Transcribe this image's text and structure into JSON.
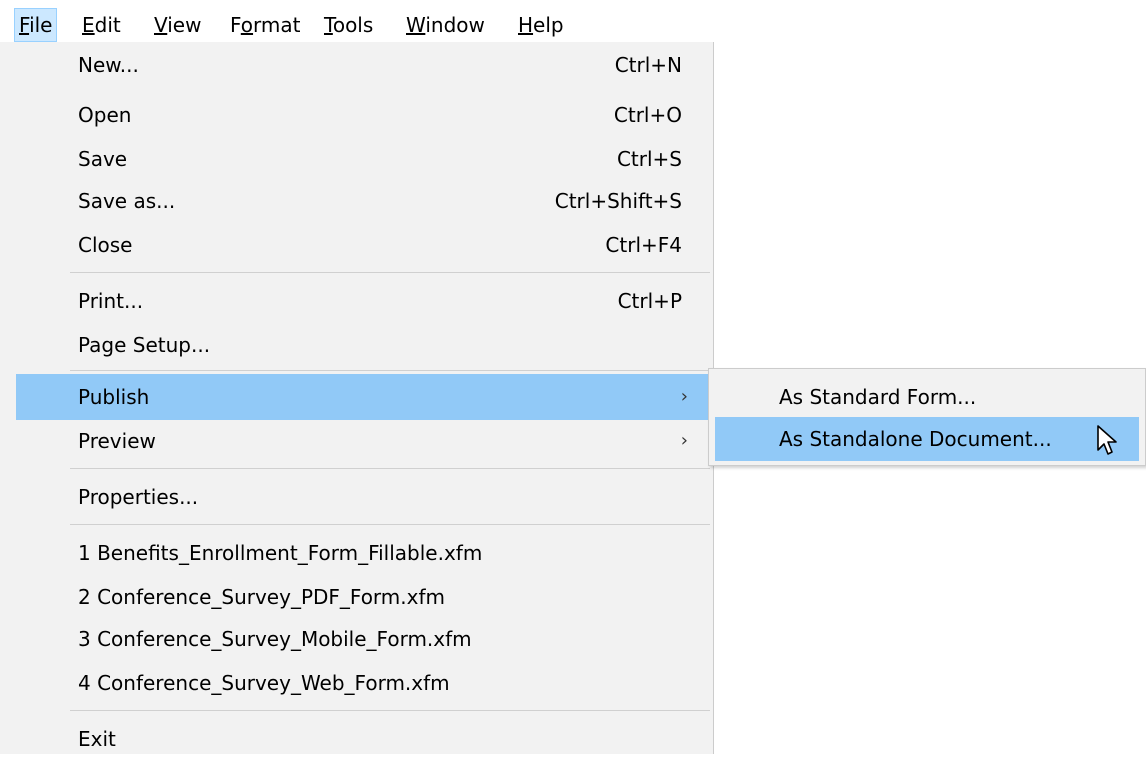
{
  "menubar": [
    {
      "pre": "",
      "key": "F",
      "post": "ile"
    },
    {
      "pre": "",
      "key": "E",
      "post": "dit"
    },
    {
      "pre": "",
      "key": "V",
      "post": "iew"
    },
    {
      "pre": "F",
      "key": "o",
      "post": "rmat"
    },
    {
      "pre": "",
      "key": "T",
      "post": "ools"
    },
    {
      "pre": "",
      "key": "W",
      "post": "indow"
    },
    {
      "pre": "",
      "key": "H",
      "post": "elp"
    }
  ],
  "file_menu": {
    "new": {
      "label": "New...",
      "shortcut": "Ctrl+N"
    },
    "open": {
      "label": "Open",
      "shortcut": "Ctrl+O"
    },
    "save": {
      "label": "Save",
      "shortcut": "Ctrl+S"
    },
    "save_as": {
      "label": "Save as...",
      "shortcut": "Ctrl+Shift+S"
    },
    "close": {
      "label": "Close",
      "shortcut": "Ctrl+F4"
    },
    "print": {
      "label": "Print...",
      "shortcut": "Ctrl+P"
    },
    "page_setup": {
      "label": "Page Setup..."
    },
    "publish": {
      "label": "Publish",
      "arrow": "›"
    },
    "preview": {
      "label": "Preview",
      "arrow": "›"
    },
    "properties": {
      "label": "Properties..."
    },
    "recent": [
      "1 Benefits_Enrollment_Form_Fillable.xfm",
      "2 Conference_Survey_PDF_Form.xfm",
      "3 Conference_Survey_Mobile_Form.xfm",
      "4 Conference_Survey_Web_Form.xfm"
    ],
    "exit": {
      "label": "Exit"
    }
  },
  "publish_submenu": {
    "items": [
      "As Standard Form...",
      "As Standalone Document..."
    ],
    "highlighted": "As Standalone Document..."
  },
  "colors": {
    "highlight": "#91c9f7",
    "menu_background": "#f2f2f2",
    "menubar_active": "#cce8ff"
  },
  "icons": {
    "cursor": "mouse-pointer-icon",
    "submenu_arrow": "chevron-right-icon"
  }
}
